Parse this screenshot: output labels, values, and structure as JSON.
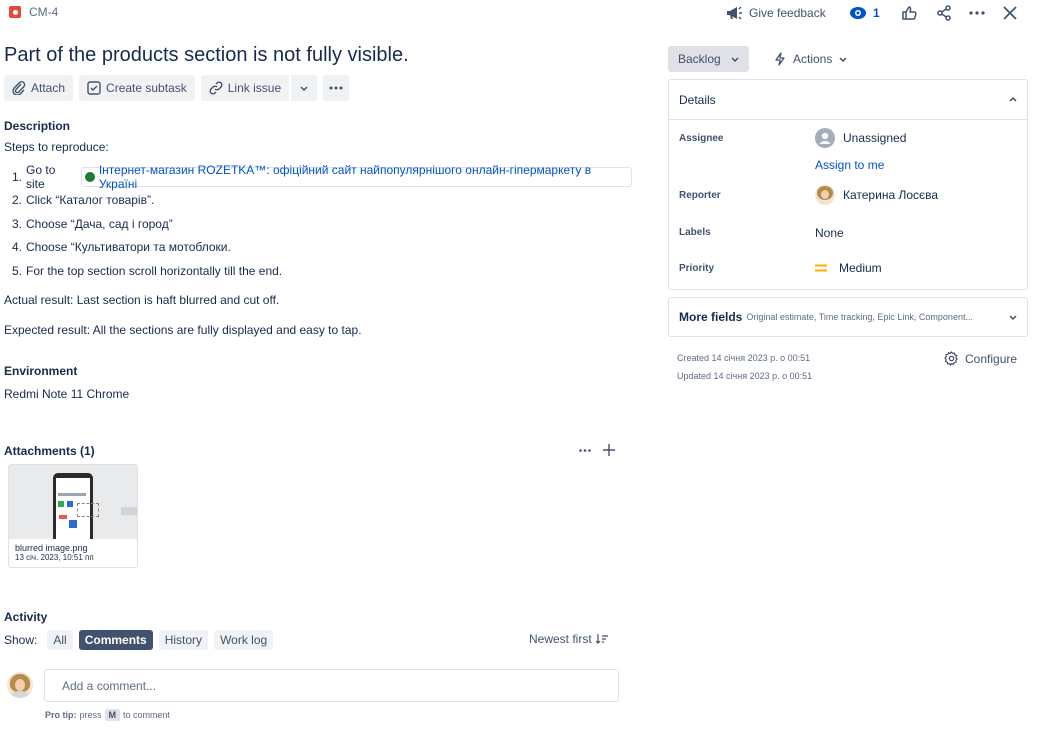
{
  "header": {
    "issue_key": "CM-4",
    "give_feedback": "Give feedback",
    "watchers_count": "1"
  },
  "issue": {
    "title": "Part of the products section is not fully visible.",
    "toolbar": {
      "attach": "Attach",
      "create_subtask": "Create subtask",
      "link_issue": "Link issue"
    },
    "description_heading": "Description",
    "steps_intro": "Steps to reproduce:",
    "steps": [
      {
        "num": "1.",
        "text": "Go to site"
      },
      {
        "num": "2.",
        "text": "Click “Каталог товарів”."
      },
      {
        "num": "3.",
        "text": "Choose “Дача, сад і город”"
      },
      {
        "num": "4.",
        "text": "Choose “Культиватори та мотоблоки."
      },
      {
        "num": "5.",
        "text": "For the top section scroll horizontally till the end."
      }
    ],
    "site_link": "Інтернет-магазин ROZETKA™: офіційний сайт найпопулярнішого онлайн-гіпермаркету в Україні",
    "actual_result": "Actual result: Last section is haft blurred and cut off.",
    "expected_result": "Expected result: All the sections are fully displayed and easy to tap.",
    "environment_heading": "Environment",
    "environment_value": "Redmi Note 11 Chrome",
    "attachments_heading": "Attachments (1)",
    "attachment": {
      "filename": "blurred image.png",
      "date": "13 січ. 2023, 10:51 пп"
    },
    "activity_heading": "Activity",
    "show_label": "Show:",
    "activity_filters": [
      "All",
      "Comments",
      "History",
      "Work log"
    ],
    "activity_active": "Comments",
    "sort_label": "Newest first",
    "comment_placeholder": "Add a comment...",
    "pro_tip_bold": "Pro tip:",
    "pro_tip_press": "press",
    "pro_tip_key": "M",
    "pro_tip_rest": "to comment"
  },
  "sidebar": {
    "status": "Backlog",
    "actions": "Actions",
    "details_heading": "Details",
    "assignee_label": "Assignee",
    "assignee_value": "Unassigned",
    "assign_to_me": "Assign to me",
    "reporter_label": "Reporter",
    "reporter_value": "Катерина Лосєва",
    "labels_label": "Labels",
    "labels_value": "None",
    "priority_label": "Priority",
    "priority_value": "Medium",
    "more_fields": "More fields",
    "more_fields_hint": "Original estimate, Time tracking, Epic Link, Component...",
    "created": "Created 14 січня 2023 р. о 00:51",
    "updated": "Updated 14 січня 2023 р. о 00:51",
    "configure": "Configure"
  },
  "colors": {
    "issue_type": "#e5493a",
    "priority": "#ffab00",
    "link": "#0052cc",
    "active_chip": "#42526e"
  }
}
